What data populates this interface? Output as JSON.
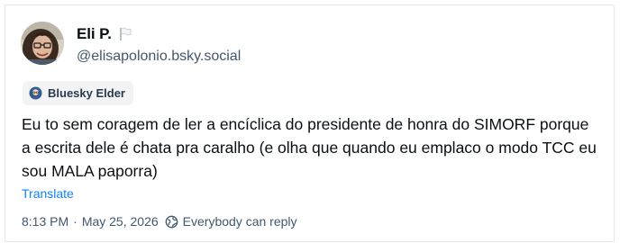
{
  "post": {
    "author": {
      "display_name": "Eli P.",
      "handle": "@elisapolonio.bsky.social",
      "avatar_icon": "avatar-photo",
      "flag_icon": "white-flag-icon"
    },
    "badge": {
      "icon": "bluesky-elder-icon",
      "label": "Bluesky Elder"
    },
    "text": "Eu to sem coragem de ler a encíclica do presidente de honra do SIMORF porque a escrita dele é chata pra caralho (e olha que quando eu emplaco o modo TCC eu sou MALA paporra)",
    "translate_label": "Translate",
    "time": "8:13 PM",
    "separator": "·",
    "date": "May 25, 2026",
    "reply_setting": {
      "icon": "globe-icon",
      "label": "Everybody can reply"
    }
  },
  "colors": {
    "text_primary": "#0b0f14",
    "text_secondary": "#42576c",
    "link": "#1083fe",
    "badge_bg": "#f1f3f5",
    "border": "#e4e8ee"
  }
}
